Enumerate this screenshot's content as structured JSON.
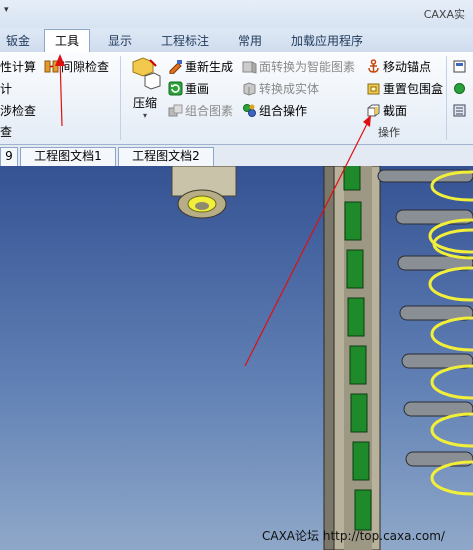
{
  "titlebar": {
    "sysmenu": "▾",
    "title": "CAXA实"
  },
  "tabs": [
    {
      "label": "钣金"
    },
    {
      "label": "工具"
    },
    {
      "label": "显示"
    },
    {
      "label": "工程标注"
    },
    {
      "label": "常用"
    },
    {
      "label": "加载应用程序"
    }
  ],
  "ribbon": {
    "left_col": [
      "性计算",
      "计",
      "涉检查",
      "查"
    ],
    "gap_check": "间隙检查",
    "compress": "压缩",
    "regenerate": "重新生成",
    "redraw": "重画",
    "combine_graphic": "组合图素",
    "face_to_smart": "面转换为智能图素",
    "to_solid": "转换成实体",
    "combine_op": "组合操作",
    "move_anchor": "移动锚点",
    "reset_bbox": "重置包围盒",
    "section": "截面",
    "group_label": "操作"
  },
  "doc_tabs": [
    {
      "label": "9"
    },
    {
      "label": "工程图文档1"
    },
    {
      "label": "工程图文档2"
    }
  ],
  "watermark": "CAXA论坛 http://top.caxa.com/",
  "colors": {
    "viewport_top": "#355293",
    "viewport_bottom": "#8fa8c9",
    "annotation_arrow": "#e01010",
    "part_green": "#1f8a2a",
    "spring_yellow": "#f1ef3a"
  }
}
